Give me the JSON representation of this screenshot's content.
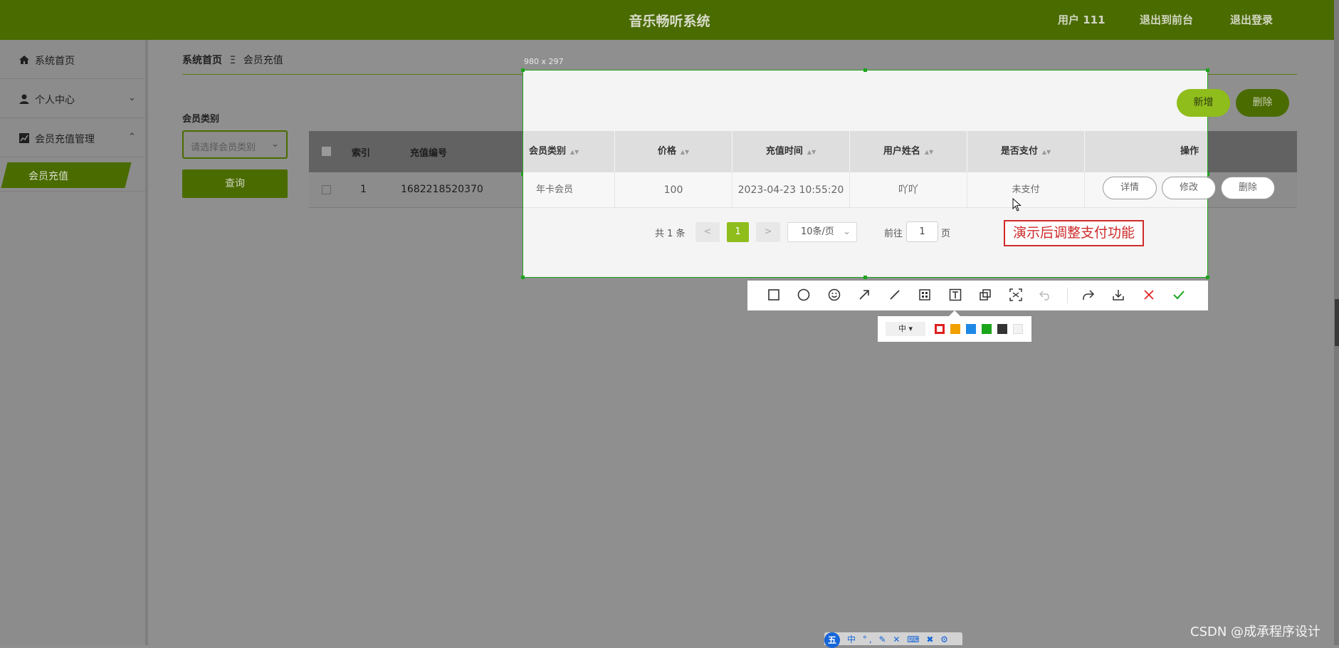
{
  "header": {
    "title": "音乐畅听系统",
    "user": "用户 111",
    "front": "退出到前台",
    "logout": "退出登录"
  },
  "sidebar": {
    "items": [
      {
        "label": "系统首页"
      },
      {
        "label": "个人中心"
      },
      {
        "label": "会员充值管理"
      }
    ],
    "sub_item": "会员充值"
  },
  "breadcrumb": {
    "home": "系统首页",
    "sep": "Ξ",
    "current": "会员充值"
  },
  "filter": {
    "label": "会员类别",
    "placeholder": "请选择会员类别",
    "query": "查询"
  },
  "bg_table": {
    "headers": [
      "索引",
      "充值编号"
    ],
    "row": {
      "index": "1",
      "number": "1682218520370"
    }
  },
  "capture": {
    "size_label": "980 x 297"
  },
  "actions": {
    "add": "新增",
    "delete": "删除"
  },
  "table": {
    "headers": [
      "会员类别",
      "价格",
      "充值时间",
      "用户姓名",
      "是否支付",
      "操作"
    ],
    "rows": [
      {
        "type": "年卡会员",
        "price": "100",
        "time": "2023-04-23 10:55:20",
        "user": "吖吖",
        "paid": "未支付"
      }
    ],
    "row_buttons": {
      "detail": "详情",
      "edit": "修改",
      "delete": "删除"
    }
  },
  "pagination": {
    "total": "共 1 条",
    "prev": "<",
    "current": "1",
    "next": ">",
    "page_size": "10条/页",
    "goto": "前往",
    "goto_value": "1",
    "page_suffix": "页"
  },
  "annotation": "演示后调整支付功能",
  "snip_toolbar": {
    "tools": [
      "rectangle-icon",
      "ellipse-icon",
      "emoji-icon",
      "arrow-icon",
      "line-icon",
      "mosaic-icon",
      "text-icon",
      "copy-icon",
      "ocr-icon",
      "undo-icon",
      "share-icon",
      "download-icon",
      "cancel-icon",
      "confirm-icon"
    ],
    "size": "中",
    "colors": [
      "#e01e1e",
      "#f0a000",
      "#1e88e5",
      "#1aa51a",
      "#333333",
      "#f2f2f2"
    ]
  },
  "ime": {
    "logo": "五",
    "glyphs": "中 °, ✎ ✕ ⌨ ✖ ⚙"
  },
  "watermark": "CSDN @成承程序设计"
}
